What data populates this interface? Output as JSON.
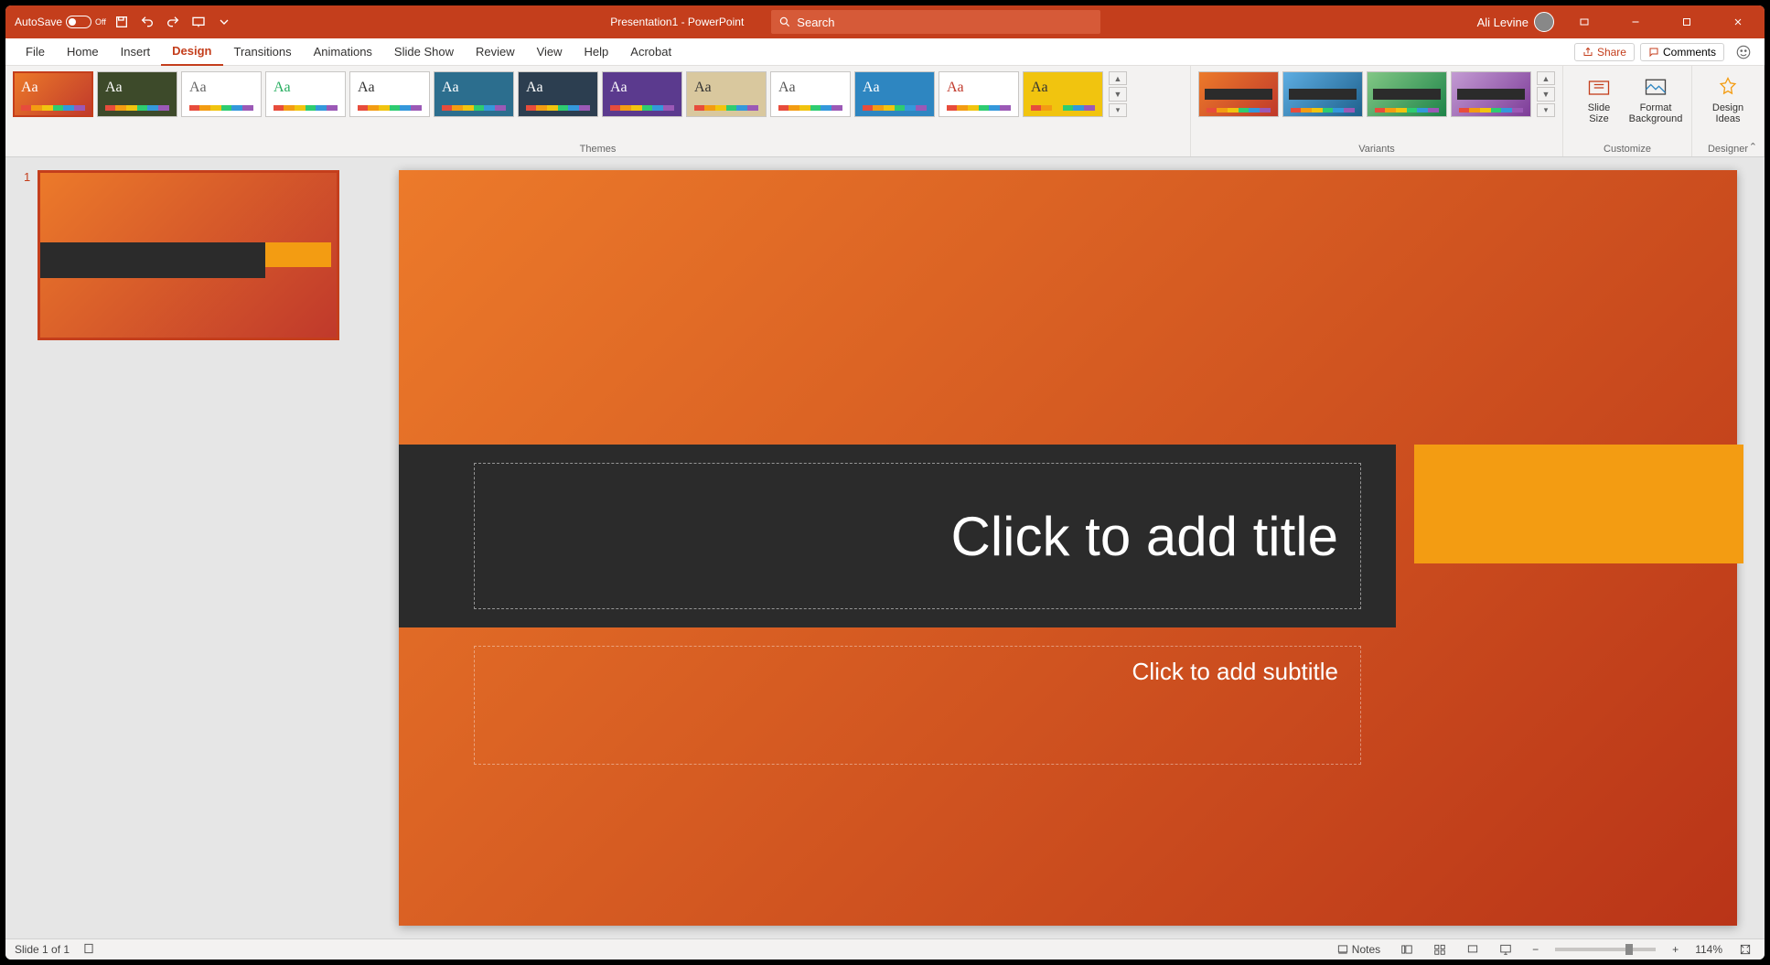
{
  "titlebar": {
    "autosave_label": "AutoSave",
    "autosave_state": "Off",
    "doc_title": "Presentation1 - PowerPoint",
    "search_placeholder": "Search",
    "user_name": "Ali Levine"
  },
  "tabs": {
    "items": [
      "File",
      "Home",
      "Insert",
      "Design",
      "Transitions",
      "Animations",
      "Slide Show",
      "Review",
      "View",
      "Help",
      "Acrobat"
    ],
    "active": "Design",
    "share": "Share",
    "comments": "Comments"
  },
  "ribbon": {
    "themes_label": "Themes",
    "variants_label": "Variants",
    "customize_label": "Customize",
    "designer_label": "Designer",
    "slide_size": "Slide Size",
    "format_bg": "Format Background",
    "design_ideas": "Design Ideas",
    "themes": [
      {
        "bg": "linear-gradient(135deg,#ec7a2a,#c0392b)",
        "aa": "#fff",
        "selected": true
      },
      {
        "bg": "#3d4a2a",
        "aa": "#fff"
      },
      {
        "bg": "#ffffff",
        "aa": "#666"
      },
      {
        "bg": "#ffffff",
        "aa": "#27ae60"
      },
      {
        "bg": "#ffffff",
        "aa": "#333"
      },
      {
        "bg": "#2c6e8e",
        "aa": "#fff"
      },
      {
        "bg": "#2c3e50",
        "aa": "#fff"
      },
      {
        "bg": "#5b3a8e",
        "aa": "#fff"
      },
      {
        "bg": "#d9c89e",
        "aa": "#333"
      },
      {
        "bg": "#ffffff",
        "aa": "#555"
      },
      {
        "bg": "#2e86c1",
        "aa": "#fff"
      },
      {
        "bg": "#ffffff",
        "aa": "#c0392b"
      },
      {
        "bg": "#f1c40f",
        "aa": "#333"
      }
    ],
    "variants": [
      {
        "bg": "linear-gradient(135deg,#ec7a2a,#c0392b)"
      },
      {
        "bg": "linear-gradient(135deg,#5dade2,#1f618d)"
      },
      {
        "bg": "linear-gradient(135deg,#82c785,#1e8449)"
      },
      {
        "bg": "linear-gradient(135deg,#c39bd3,#7d3c98)"
      }
    ]
  },
  "slidepanel": {
    "slides": [
      {
        "num": "1"
      }
    ]
  },
  "canvas": {
    "title_placeholder": "Click to add title",
    "subtitle_placeholder": "Click to add subtitle"
  },
  "statusbar": {
    "slide_info": "Slide 1 of 1",
    "notes": "Notes",
    "zoom": "114%"
  }
}
